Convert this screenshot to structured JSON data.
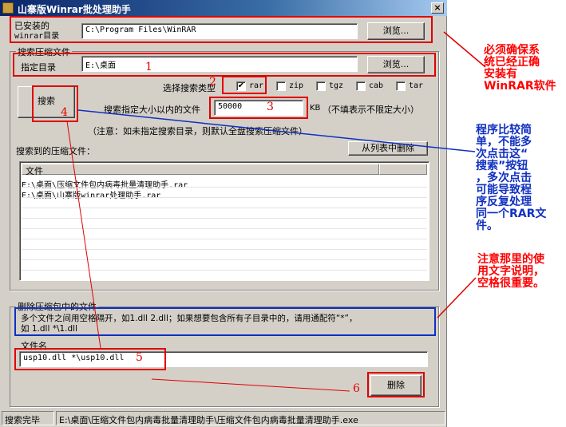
{
  "window": {
    "title": "山寨版Winrar批处理助手",
    "close_label": "×"
  },
  "install": {
    "label_line1": "已安装的",
    "label_line2": "winrar目录",
    "path": "C:\\Program Files\\WinRAR",
    "browse_label": "浏览..."
  },
  "search_group": {
    "title": "搜索压缩文件"
  },
  "target": {
    "label": "指定目录",
    "path": "E:\\桌面",
    "browse_label": "浏览..."
  },
  "types": {
    "label": "选择搜索类型",
    "options": [
      {
        "name": "rar",
        "checked": true,
        "mark": "✔"
      },
      {
        "name": "zip",
        "checked": false,
        "mark": ""
      },
      {
        "name": "tgz",
        "checked": false,
        "mark": ""
      },
      {
        "name": "cab",
        "checked": false,
        "mark": ""
      },
      {
        "name": "tar",
        "checked": false,
        "mark": ""
      }
    ]
  },
  "search_button_label": "搜索",
  "size": {
    "label": "搜索指定大小以内的文件",
    "value": "50000",
    "unit": "KB",
    "hint": "（不填表示不限定大小）"
  },
  "search_note": "（注意：如未指定搜索目录，则默认全盘搜索压缩文件）",
  "results": {
    "label": "搜索到的压缩文件：",
    "clear_label": "从列表中删除",
    "column": "文件",
    "rows": [
      "E:\\桌面\\压缩文件包内病毒批量清理助手.rar",
      "E:\\桌面\\山寨版winrar处理助手.rar"
    ]
  },
  "delete_group": {
    "title": "删除压缩包中的文件",
    "instructions_line1": "多个文件之间用空格隔开，如1.dll 2.dll；如果想要包含所有子目录中的，请用通配符“*”，",
    "instructions_line2": "如 1.dll *\\1.dll",
    "filename_label": "文件名",
    "filename_value": "usp10.dll *\\usp10.dll",
    "delete_label": "删除"
  },
  "status": {
    "left": "搜索完毕",
    "right": "E:\\桌面\\压缩文件包内病毒批量清理助手\\压缩文件包内病毒批量清理助手.exe"
  },
  "annotations": {
    "steps": [
      "1",
      "2",
      "3",
      "4",
      "5",
      "6"
    ],
    "note_install": [
      "必须确保系",
      "统已经正确",
      "安装有",
      "WinRAR软件"
    ],
    "note_search": [
      "程序比较简",
      "单，不能多",
      "次点击这“",
      "搜索”按钮",
      "，多次点击",
      "可能导致程",
      "序反复处理",
      "同一个RAR文",
      "件。"
    ],
    "note_spaces": [
      "注意那里的使",
      "用文字说明，",
      "空格很重要。"
    ],
    "colors": {
      "red": "#e00000",
      "blue": "#1030c0"
    }
  }
}
